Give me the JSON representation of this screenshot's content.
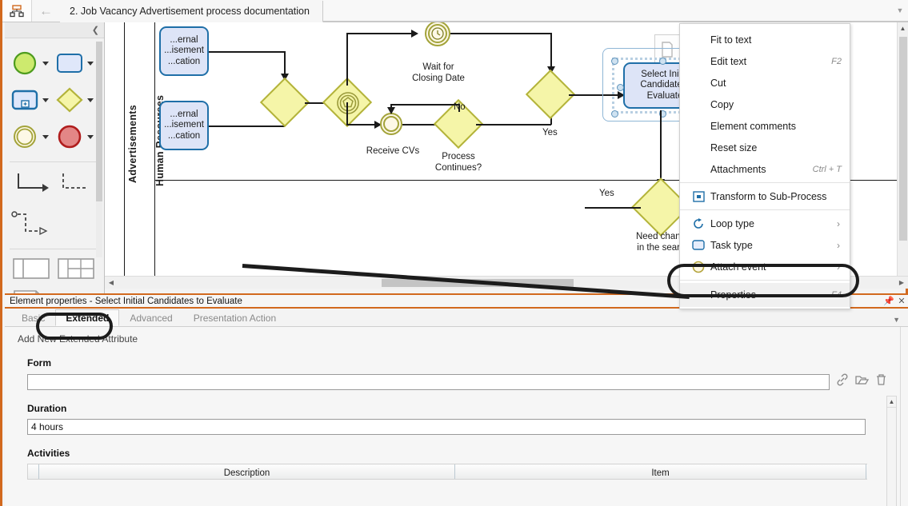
{
  "window": {
    "tab_title": "2. Job Vacancy Advertisement process documentation",
    "app_icon": "hierarchy-icon",
    "back_icon": "back-arrow-icon",
    "overflow_icon": "chevron-down-icon"
  },
  "palette": {
    "collapse_icon": "chevron-left-icon",
    "items": [
      {
        "name": "start-event",
        "icon": "green-circle-icon"
      },
      {
        "name": "task",
        "icon": "rounded-rect-icon"
      },
      {
        "name": "sub-process",
        "icon": "subprocess-icon"
      },
      {
        "name": "gateway",
        "icon": "yellow-diamond-icon"
      },
      {
        "name": "intermediate-event",
        "icon": "double-circle-icon"
      },
      {
        "name": "end-event",
        "icon": "red-circle-icon"
      },
      {
        "name": "sequence-flow",
        "icon": "solid-connector-icon"
      },
      {
        "name": "message-flow",
        "icon": "dashed-connector-icon"
      },
      {
        "name": "association",
        "icon": "association-connector-icon"
      },
      {
        "name": "pool",
        "icon": "pool-icon"
      },
      {
        "name": "lane-grid",
        "icon": "lane-grid-icon"
      },
      {
        "name": "annotation",
        "icon": "text-annotation-icon"
      }
    ]
  },
  "diagram": {
    "pools": [
      {
        "label": "Advertisements"
      },
      {
        "label": "Human Resourses"
      }
    ],
    "tasks": [
      {
        "id": "t1",
        "label": "...ernal\n...isement\n...cation"
      },
      {
        "id": "t2",
        "label": "...ernal\n...isement\n...cation"
      },
      {
        "id": "t3",
        "label": "Select Initia\nCandidates \nEvaluate",
        "selected": true
      }
    ],
    "labels": [
      {
        "id": "l-wait",
        "text": "Wait for\nClosing Date"
      },
      {
        "id": "l-receive",
        "text": "Receive CVs"
      },
      {
        "id": "l-process",
        "text": "Process\nContinues?"
      },
      {
        "id": "l-no",
        "text": "No"
      },
      {
        "id": "l-yes1",
        "text": "Yes"
      },
      {
        "id": "l-yes2",
        "text": "Yes"
      },
      {
        "id": "l-need",
        "text": "Need chang\nin the searc"
      }
    ],
    "note_icon": "document-annotation-icon"
  },
  "context_menu": {
    "items": [
      {
        "label": "Fit to text",
        "shortcut": "",
        "icon": null,
        "submenu": false
      },
      {
        "label": "Edit text",
        "shortcut": "F2",
        "icon": null,
        "submenu": false
      },
      {
        "label": "Cut",
        "shortcut": "",
        "icon": null,
        "submenu": false
      },
      {
        "label": "Copy",
        "shortcut": "",
        "icon": null,
        "submenu": false
      },
      {
        "label": "Element comments",
        "shortcut": "",
        "icon": null,
        "submenu": false
      },
      {
        "label": "Reset size",
        "shortcut": "",
        "icon": null,
        "submenu": false
      },
      {
        "label": "Attachments",
        "shortcut": "Ctrl + T",
        "icon": null,
        "submenu": false
      },
      {
        "label": "Transform to Sub-Process",
        "shortcut": "",
        "icon": "subprocess-icon",
        "submenu": false
      },
      {
        "label": "Loop type",
        "shortcut": "",
        "icon": "loop-icon",
        "submenu": true
      },
      {
        "label": "Task type",
        "shortcut": "",
        "icon": "task-icon",
        "submenu": true
      },
      {
        "label": "Attach event",
        "shortcut": "",
        "icon": "event-circle-icon",
        "submenu": true
      },
      {
        "label": "Properties",
        "shortcut": "F4",
        "icon": null,
        "submenu": false,
        "highlighted": true
      }
    ],
    "submenu_indicator": "›"
  },
  "properties": {
    "title": "Element properties - Select Initial Candidates to Evaluate",
    "pin_icon": "pin-icon",
    "close_icon": "close-icon",
    "tabs_overflow_icon": "chevron-down-icon",
    "tabs": [
      {
        "label": "Basic",
        "active": false
      },
      {
        "label": "Extended",
        "active": true
      },
      {
        "label": "Advanced",
        "active": false
      },
      {
        "label": "Presentation Action",
        "active": false
      }
    ],
    "add_new_link": "Add New Extended Attribute",
    "fields": [
      {
        "label": "Form",
        "value": "",
        "placeholder": ""
      },
      {
        "label": "Duration",
        "value": "4 hours",
        "placeholder": ""
      }
    ],
    "field_icons": [
      {
        "name": "link-icon",
        "glyph": "🔗"
      },
      {
        "name": "open-folder-icon",
        "glyph": "📂"
      },
      {
        "name": "delete-icon",
        "glyph": "🗑"
      }
    ],
    "activities": {
      "label": "Activities",
      "columns": [
        "Description",
        "Item"
      ]
    }
  },
  "scrollbars": {
    "up_arrow": "▲",
    "down_arrow": "▼",
    "left_arrow": "◀",
    "right_arrow": "▶"
  },
  "colors": {
    "accent_orange": "#d2691e",
    "task_fill": "#dde4f7",
    "task_border": "#1f6fa8",
    "gateway_fill": "#f5f5a8",
    "gateway_border": "#b3b33a",
    "event_border": "#a3a33a"
  }
}
